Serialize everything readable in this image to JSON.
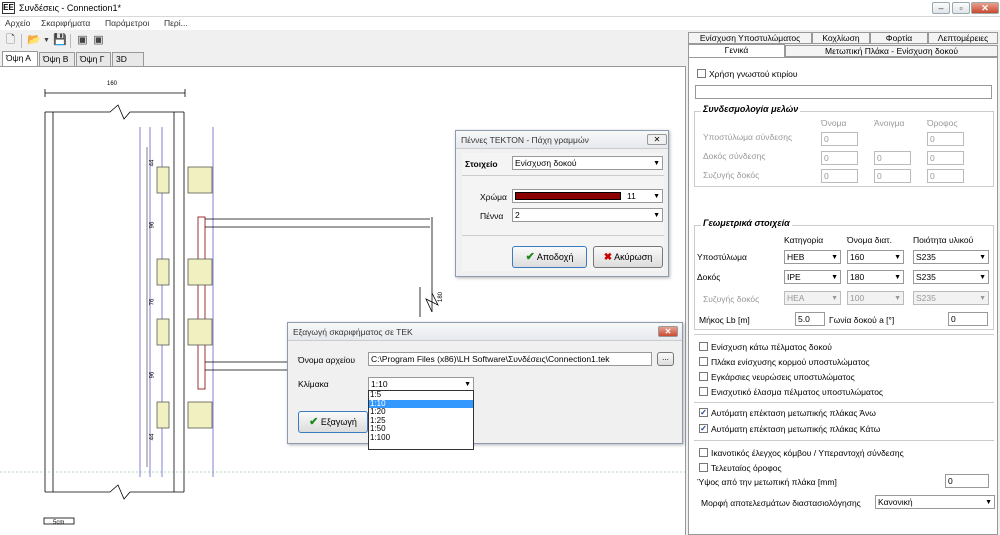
{
  "window": {
    "title": "Συνδέσεις - Connection1*",
    "app_icon": "ΕΕ",
    "minimize": "–",
    "maximize": "▫",
    "close": "✕"
  },
  "menu": [
    "Αρχείο",
    "Σκαριφήματα",
    "Παράμετροι",
    "Περί..."
  ],
  "canvas_tabs": [
    "Όψη Α",
    "Όψη Β",
    "Όψη Γ",
    "3D"
  ],
  "drawing": {
    "top_dim": "160",
    "dims_left": [
      "44",
      "96",
      "76",
      "96",
      "44"
    ],
    "right_dim": "180",
    "scale_label": "5cm"
  },
  "panel_tabs_top": [
    "Ενίσχυση Υποστυλώματος",
    "Κοχλίωση",
    "Φορτία",
    "Λεπτομέρειες"
  ],
  "panel_tabs_bottom": [
    "Γενικά",
    "Μετωπική Πλάκα - Ενίσχυση δοκού"
  ],
  "general": {
    "use_known_building": "Χρήση γνωστού κτιρίου",
    "members_group": "Συνδεσμολογία μελών",
    "col_headers": [
      "Όνομα",
      "Άνοιγμα",
      "Όροφος"
    ],
    "rows": [
      {
        "label": "Υποστύλωμα σύνδεσης",
        "name": "0",
        "span": "",
        "floor": "0"
      },
      {
        "label": "Δοκός σύνδεσης",
        "name": "0",
        "span": "0",
        "floor": "0"
      },
      {
        "label": "Συζυγής δοκός",
        "name": "0",
        "span": "0",
        "floor": "0"
      }
    ],
    "geom_group": "Γεωμετρικά στοιχεία",
    "geom_headers": [
      "Κατηγορία",
      "Όνομα διατ.",
      "Ποιότητα υλικού"
    ],
    "geom_rows": [
      {
        "label": "Υποστύλωμα",
        "cat": "HEB",
        "size": "160",
        "mat": "S235",
        "disabled": false
      },
      {
        "label": "Δοκός",
        "cat": "IPE",
        "size": "180",
        "mat": "S235",
        "disabled": false
      },
      {
        "label": "Συζυγής δοκός",
        "cat": "HEA",
        "size": "100",
        "mat": "S235",
        "disabled": true
      }
    ],
    "length_label": "Μήκος Lb [m]",
    "length_value": "5.0",
    "angle_label": "Γωνία δοκού a [°]",
    "angle_value": "0",
    "options1": [
      "Ενίσχυση κάτω πέλματος δοκού",
      "Πλάκα ενίσχυσης κορμού υποστυλώματος",
      "Εγκάρσιες νευρώσεις υποστυλώματος",
      "Ενισχυτικό έλασμα πέλματος υποστυλώματος"
    ],
    "options2": [
      {
        "label": "Αυτόματη επέκταση μετωπικής πλάκας Άνω",
        "checked": true
      },
      {
        "label": "Αυτόματη επέκταση μετωπικής πλάκας Κάτω",
        "checked": true
      }
    ],
    "options3": [
      "Ικανοτικός έλεγχος κόμβου / Υπεραντοχή σύνδεσης",
      "Τελευταίος όροφος"
    ],
    "height_label": "Ύψος από την μετωπική πλάκα [mm]",
    "height_value": "0",
    "results_label": "Μορφή αποτελεσμάτων διαστασιολόγησης",
    "results_value": "Κανονική"
  },
  "pen_dialog": {
    "title": "Πέννες TEKTON - Πάχη γραμμών",
    "element_label": "Στοιχείο",
    "element_value": "Ενίσχυση δοκού",
    "color_label": "Χρώμα",
    "color_value": "11",
    "color_swatch": "#8b0000",
    "pen_label": "Πέννα",
    "pen_value": "2",
    "ok": "Αποδοχή",
    "cancel": "Ακύρωση"
  },
  "export_dialog": {
    "title": "Εξαγωγή σκαριφήματος σε ΤΕΚ",
    "file_label": "Όνομα αρχείου",
    "file_value": "C:\\Program Files (x86)\\LH Software\\Συνδέσεις\\Connection1.tek",
    "browse": "...",
    "scale_label": "Κλίμακα",
    "scale_value": "1:10",
    "scale_options": [
      "1:5",
      "1:10",
      "1:20",
      "1:25",
      "1:50",
      "1:100"
    ],
    "scale_selected_index": 1,
    "export_btn": "Εξαγωγή"
  }
}
